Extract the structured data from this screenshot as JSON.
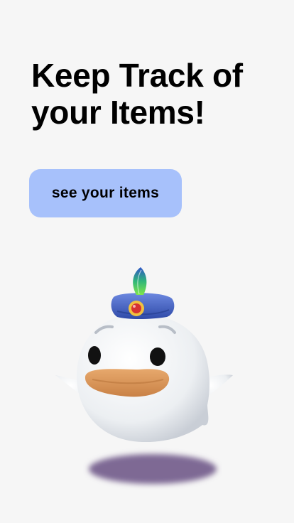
{
  "main": {
    "headline_line1": "Keep Track of",
    "headline_line2": "your Items!",
    "cta_label": "see your items"
  },
  "illustration": {
    "character": "ghost-mascot-icon"
  },
  "colors": {
    "background": "#f6f6f6",
    "button": "#a7c1fb",
    "shadow": "#7e6994"
  }
}
